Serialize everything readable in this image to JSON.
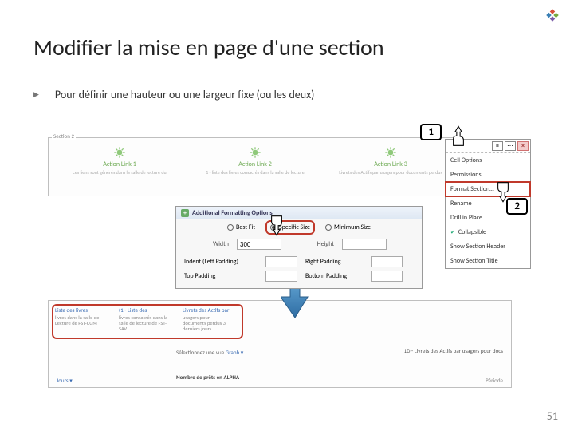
{
  "slide": {
    "title": "Modifier la mise en page d'une section",
    "bullet": "Pour définir une hauteur ou une largeur fixe (ou les deux)",
    "page_number": "51"
  },
  "callouts": {
    "one": "1",
    "two": "2"
  },
  "section": {
    "label": "Section 2",
    "cols": [
      {
        "title": "Action Link 1",
        "sub": "ces liens sont générés dans la salle de lecture du"
      },
      {
        "title": "Action Link 2",
        "sub": "1 - liste des livres consacrés dans la salle de lecture"
      },
      {
        "title": "Action Link 3",
        "sub": "Livrets des Actifs par usagers pour documents perdus"
      }
    ]
  },
  "context_menu": {
    "items": [
      {
        "label": "Cell Options"
      },
      {
        "label": "Permissions"
      },
      {
        "label": "Format Section…",
        "selected": true
      },
      {
        "label": "Rename"
      },
      {
        "label": "Drill in Place"
      },
      {
        "label": "Collapsible",
        "checked": true
      },
      {
        "label": "Show Section Header"
      },
      {
        "label": "Show Section Title"
      }
    ]
  },
  "dialog": {
    "title": "Additional Formatting Options",
    "radios": {
      "best": "Best Fit",
      "specific": "Specific Size",
      "minimum": "Minimum Size"
    },
    "rows": {
      "width_label": "Width",
      "width_value": "300",
      "height_label": "Height",
      "indent_label": "Indent (Left Padding)",
      "right_label": "Right Padding",
      "top_label": "Top Padding",
      "bottom_label": "Bottom Padding"
    }
  },
  "result": {
    "cols": [
      {
        "hdr": "Liste des livres",
        "txt": "livres dans la salle de Lecture de FST-CGM"
      },
      {
        "hdr": "(1 - Liste des",
        "txt": "livres consacrés dans la salle de lecture de FST-SAV"
      },
      {
        "hdr": "Livrets des Actifs par",
        "txt": "usagers pour documents perdus 3 derniers jours"
      }
    ],
    "mid_label": "Sélectionnez une vue",
    "mid_value": "Graph",
    "right": "1D - Livrets des Actifs par usagers pour docs",
    "bottom": "Nombre de prêts en ALPHA",
    "foot_left": "Jours",
    "foot_right": "Période"
  }
}
